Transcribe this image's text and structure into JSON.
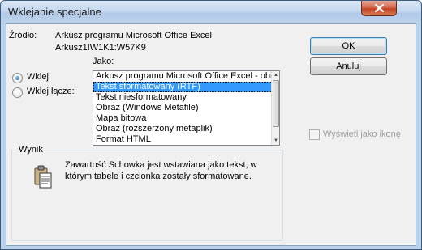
{
  "window": {
    "title": "Wklejanie specjalne"
  },
  "source": {
    "label": "Źródło:",
    "line1": "Arkusz programu Microsoft Office Excel",
    "line2": "Arkusz1!W1K1:W57K9"
  },
  "format_label": "Jako:",
  "paste_options": [
    {
      "label": "Wklej:",
      "selected": true
    },
    {
      "label": "Wklej łącze:",
      "selected": false
    }
  ],
  "formats": [
    "Arkusz programu Microsoft Office Excel - obi",
    "Tekst sformatowany (RTF)",
    "Tekst niesformatowany",
    "Obraz (Windows Metafile)",
    "Mapa bitowa",
    "Obraz (rozszerzony metaplik)",
    "Format HTML"
  ],
  "selected_format": "Tekst sformatowany (RTF)",
  "buttons": {
    "ok": "OK",
    "cancel": "Anuluj"
  },
  "display_as_icon": {
    "label": "Wyświetl jako ikonę",
    "checked": false,
    "enabled": false
  },
  "result": {
    "title": "Wynik",
    "line1": "Zawartość Schowka jest wstawiana jako tekst, w",
    "line2": "którym tabele i czcionka zostały sformatowane."
  },
  "icons": {
    "close": "close-icon",
    "result": "clipboard-icon"
  },
  "colors": {
    "selection": "#3399ff",
    "close_button": "#c34324",
    "title_bar": "#c3d7ef"
  }
}
